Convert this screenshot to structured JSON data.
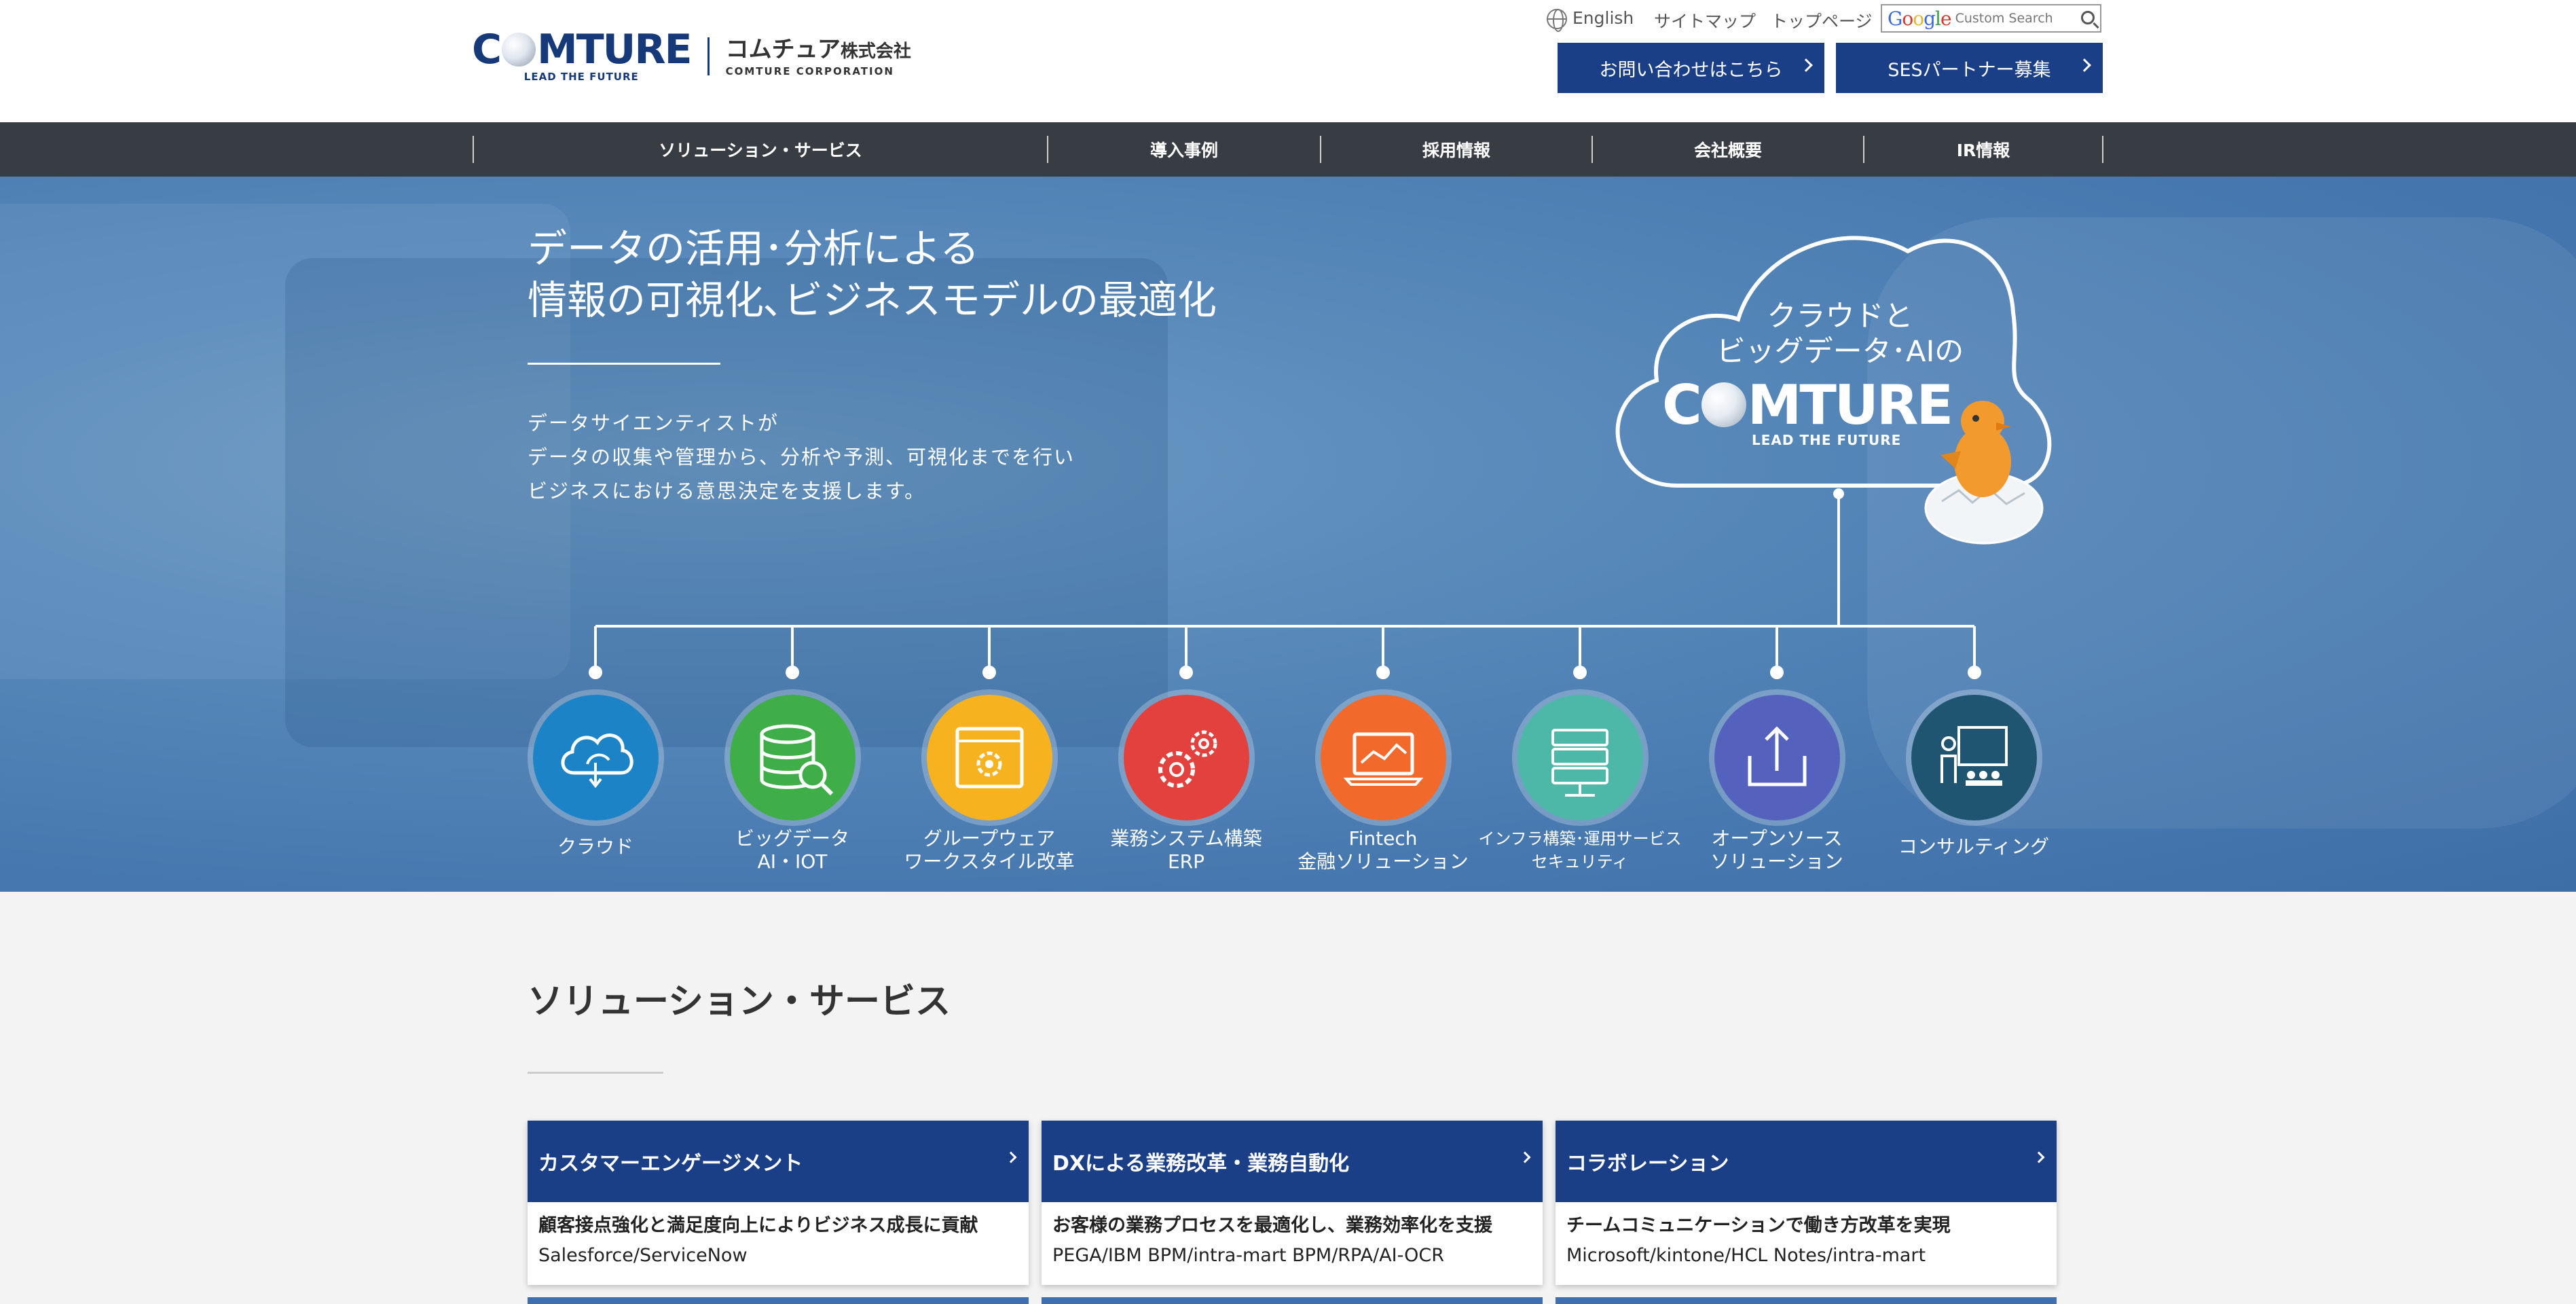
{
  "header": {
    "logo": {
      "word": "COMTURE",
      "tagline": "LEAD THE FUTURE",
      "jp_main": "コムチュア",
      "jp_suffix": "株式会社",
      "jp_sub": "COMTURE CORPORATION"
    },
    "util_links": [
      "English",
      "サイトマップ",
      "トップページ"
    ],
    "search": {
      "brand": "Google",
      "placeholder": "Custom Search"
    },
    "cta": {
      "contact_label": "お問い合わせはこちら",
      "partner_label": "SESパートナー募集"
    }
  },
  "nav": {
    "items": [
      "ソリューション・サービス",
      "導入事例",
      "採用情報",
      "会社概要",
      "IR情報"
    ]
  },
  "hero": {
    "title_line1": "データの活用･分析による",
    "title_line2": "情報の可視化､ビジネスモデルの最適化",
    "body_line1": "データサイエンティストが",
    "body_line2": "データの収集や管理から、分析や予測、可視化までを行い",
    "body_line3": "ビジネスにおける意思決定を支援します。",
    "cloud_line1": "クラウドと",
    "cloud_line2": "ビッグデータ･AIの",
    "cloud_logo": "COMTURE",
    "cloud_tagline": "LEAD THE FUTURE",
    "services": [
      {
        "line1": "クラウド",
        "line2": "",
        "color": "#1b83c6",
        "icon": "cloud-sync-icon"
      },
      {
        "line1": "ビッグデータ",
        "line2": "AI・IOT",
        "color": "#3fae49",
        "icon": "database-search-icon"
      },
      {
        "line1": "グループウェア",
        "line2": "ワークスタイル改革",
        "color": "#f7b31f",
        "icon": "window-gear-icon"
      },
      {
        "line1": "業務システム構築",
        "line2": "ERP",
        "color": "#e2413e",
        "icon": "gears-icon"
      },
      {
        "line1": "Fintech",
        "line2": "金融ソリューション",
        "color": "#f26a2b",
        "icon": "laptop-chart-icon"
      },
      {
        "line1": "インフラ構築･運用サービス",
        "line2": "セキュリティ",
        "color": "#4db8a7",
        "icon": "server-icon"
      },
      {
        "line1": "オープンソース",
        "line2": "ソリューション",
        "color": "#5562bd",
        "icon": "upload-icon"
      },
      {
        "line1": "コンサルティング",
        "line2": "",
        "color": "#1f5571",
        "icon": "presentation-icon"
      }
    ]
  },
  "solutions": {
    "title": "ソリューション・サービス",
    "cards": [
      {
        "title": "カスタマーエンゲージメント",
        "desc": "顧客接点強化と満足度向上によりビジネス成長に貢献",
        "tags": "Salesforce/ServiceNow"
      },
      {
        "title": "DXによる業務改革・業務自動化",
        "desc": "お客様の業務プロセスを最適化し、業務効率化を支援",
        "tags": "PEGA/IBM BPM/intra-mart BPM/RPA/AI-OCR"
      },
      {
        "title": "コラボレーション",
        "desc": "チームコミュニケーションで働き方改革を実現",
        "tags": "Microsoft/kintone/HCL Notes/intra-mart"
      }
    ]
  },
  "colors": {
    "brand_navy": "#1b3f86",
    "nav_bg": "#383d44",
    "hero_blue": "#4f82b6"
  }
}
